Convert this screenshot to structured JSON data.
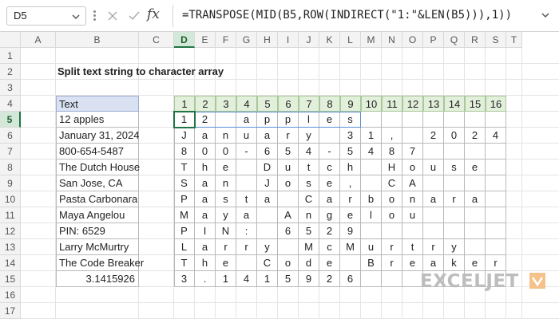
{
  "formula_bar": {
    "name_box": "D5",
    "fx_label": "fx",
    "formula": "=TRANSPOSE(MID(B5,ROW(INDIRECT(\"1:\"&LEN(B5))),1))"
  },
  "columns": [
    "A",
    "B",
    "C",
    "D",
    "E",
    "F",
    "G",
    "H",
    "I",
    "J",
    "K",
    "L",
    "M",
    "N",
    "O",
    "P",
    "Q",
    "R",
    "S",
    "T"
  ],
  "rows": [
    "1",
    "2",
    "3",
    "4",
    "5",
    "6",
    "7",
    "8",
    "9",
    "10",
    "11",
    "12",
    "13",
    "14",
    "15",
    "16",
    "17"
  ],
  "active": {
    "column": "D",
    "row": "5"
  },
  "sheet": {
    "title": "Split text string to character array",
    "text_header": "Text",
    "texts": [
      "12 apples",
      "January 31, 2024",
      "800-654-5487",
      "The Dutch House",
      "San Jose, CA",
      "Pasta Carbonara",
      "Maya Angelou",
      "PIN: 6529",
      "Larry McMurtry",
      "The Code Breaker",
      "3.1415926"
    ],
    "index_headers": [
      "1",
      "2",
      "3",
      "4",
      "5",
      "6",
      "7",
      "8",
      "9",
      "10",
      "11",
      "12",
      "13",
      "14",
      "15",
      "16"
    ],
    "chars": [
      [
        "1",
        "2",
        "",
        "a",
        "p",
        "p",
        "l",
        "e",
        "s",
        "",
        "",
        "",
        "",
        "",
        "",
        ""
      ],
      [
        "J",
        "a",
        "n",
        "u",
        "a",
        "r",
        "y",
        "",
        "3",
        "1",
        ",",
        "",
        "2",
        "0",
        "2",
        "4"
      ],
      [
        "8",
        "0",
        "0",
        "-",
        "6",
        "5",
        "4",
        "-",
        "5",
        "4",
        "8",
        "7",
        "",
        "",
        "",
        ""
      ],
      [
        "T",
        "h",
        "e",
        "",
        "D",
        "u",
        "t",
        "c",
        "h",
        "",
        "H",
        "o",
        "u",
        "s",
        "e",
        ""
      ],
      [
        "S",
        "a",
        "n",
        "",
        "J",
        "o",
        "s",
        "e",
        ",",
        "",
        "C",
        "A",
        "",
        "",
        "",
        ""
      ],
      [
        "P",
        "a",
        "s",
        "t",
        "a",
        "",
        "C",
        "a",
        "r",
        "b",
        "o",
        "n",
        "a",
        "r",
        "a",
        ""
      ],
      [
        "M",
        "a",
        "y",
        "a",
        "",
        "A",
        "n",
        "g",
        "e",
        "l",
        "o",
        "u",
        "",
        "",
        "",
        ""
      ],
      [
        "P",
        "I",
        "N",
        ":",
        "",
        "6",
        "5",
        "2",
        "9",
        "",
        "",
        "",
        "",
        "",
        "",
        ""
      ],
      [
        "L",
        "a",
        "r",
        "r",
        "y",
        "",
        "M",
        "c",
        "M",
        "u",
        "r",
        "t",
        "r",
        "y",
        "",
        ""
      ],
      [
        "T",
        "h",
        "e",
        "",
        "C",
        "o",
        "d",
        "e",
        "",
        "B",
        "r",
        "e",
        "a",
        "k",
        "e",
        "r"
      ],
      [
        "3",
        ".",
        "1",
        "4",
        "1",
        "5",
        "9",
        "2",
        "6",
        "",
        "",
        "",
        "",
        "",
        "",
        ""
      ]
    ]
  },
  "brand": {
    "logo_text": "EXCELJET",
    "logo_color": "#bdbdbd",
    "accent": "#217346"
  }
}
